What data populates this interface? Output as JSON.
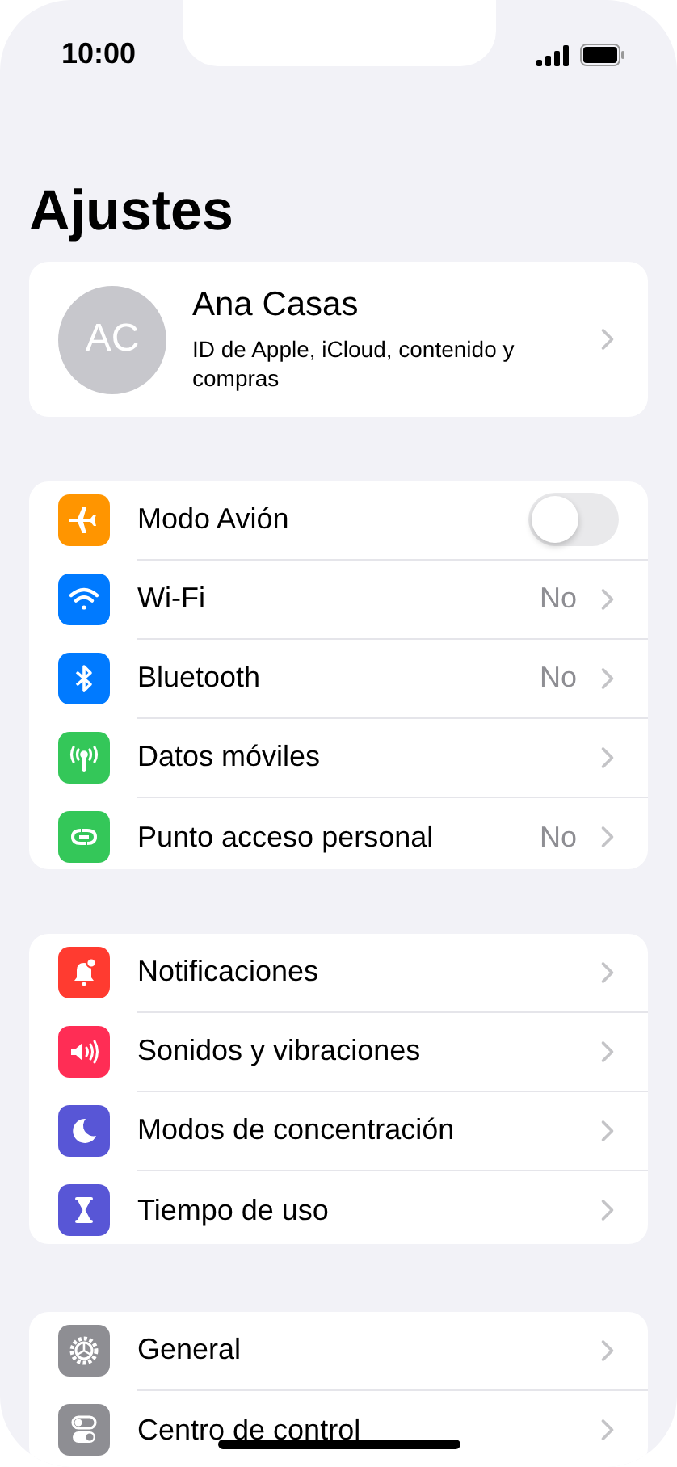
{
  "status_bar": {
    "time": "10:00"
  },
  "title": "Ajustes",
  "profile": {
    "initials": "AC",
    "name": "Ana Casas",
    "subtitle": "ID de Apple, iCloud, contenido y compras"
  },
  "groups": [
    {
      "rows": [
        {
          "kind": "toggle",
          "label": "Modo Avión",
          "color": "#ff9500",
          "on": false
        },
        {
          "kind": "link",
          "label": "Wi-Fi",
          "value": "No",
          "color": "#007aff"
        },
        {
          "kind": "link",
          "label": "Bluetooth",
          "value": "No",
          "color": "#007aff"
        },
        {
          "kind": "link",
          "label": "Datos móviles",
          "color": "#34c759"
        },
        {
          "kind": "link",
          "label": "Punto acceso personal",
          "value": "No",
          "color": "#34c759"
        }
      ]
    },
    {
      "rows": [
        {
          "kind": "link",
          "label": "Notificaciones",
          "color": "#ff3b30"
        },
        {
          "kind": "link",
          "label": "Sonidos y vibraciones",
          "color": "#ff2d55"
        },
        {
          "kind": "link",
          "label": "Modos de concentración",
          "color": "#5856d6"
        },
        {
          "kind": "link",
          "label": "Tiempo de uso",
          "color": "#5856d6"
        }
      ]
    },
    {
      "rows": [
        {
          "kind": "link",
          "label": "General",
          "color": "#8e8e93"
        },
        {
          "kind": "link",
          "label": "Centro de control",
          "color": "#8e8e93"
        }
      ]
    }
  ]
}
